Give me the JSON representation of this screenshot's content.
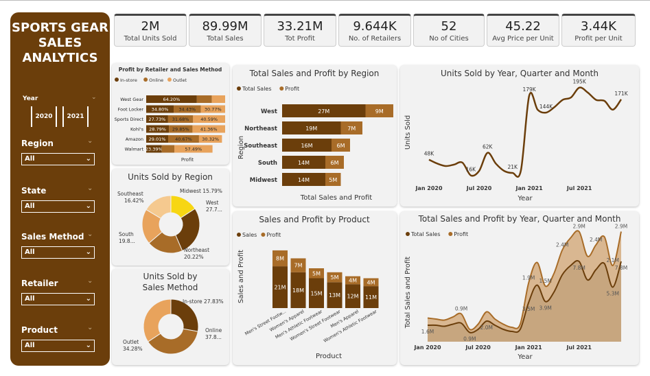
{
  "colors": {
    "dark": "#6b3e0b",
    "mid": "#a86c28",
    "light": "#e8a35c",
    "pale": "#f5c98f",
    "yellow": "#f7d613",
    "panel": "#f2f2f2"
  },
  "sidebar": {
    "title_l1": "SPORTS GEAR",
    "title_l2": "SALES",
    "title_l3": "ANALYTICS",
    "year_label": "Year",
    "year_buttons": [
      "2020",
      "2021"
    ],
    "filters": [
      {
        "label": "Region",
        "value": "All"
      },
      {
        "label": "State",
        "value": "All"
      },
      {
        "label": "Sales Method",
        "value": "All"
      },
      {
        "label": "Retailer",
        "value": "All"
      },
      {
        "label": "Product",
        "value": "All"
      }
    ]
  },
  "kpis": [
    {
      "value": "2M",
      "label": "Total Units Sold"
    },
    {
      "value": "89.99M",
      "label": "Total Sales"
    },
    {
      "value": "33.21M",
      "label": "Tot Profit"
    },
    {
      "value": "9.644K",
      "label": "No. of Retailers"
    },
    {
      "value": "52",
      "label": "No of Cities"
    },
    {
      "value": "45.22",
      "label": "Avg Price per Unit"
    },
    {
      "value": "3.44K",
      "label": "Profit per Unit"
    }
  ],
  "chart_data": [
    {
      "id": "retailer",
      "type": "bar",
      "title": "Profit by Retailer and Sales Method",
      "xlabel": "Profit",
      "legend": [
        "In-store",
        "Online",
        "Outlet"
      ],
      "categories": [
        "West Gear",
        "Foot Locker",
        "Sports Direct",
        "Kohl's",
        "Amazon",
        "Walmart"
      ],
      "totals": [
        100,
        100,
        100,
        100,
        96,
        84
      ],
      "series": [
        {
          "name": "In-store",
          "values": [
            64.2,
            34.8,
            27.73,
            28.79,
            29.01,
            23.39
          ],
          "labels": [
            "64.20%",
            "34.80%",
            "27.73%",
            "28.79%",
            "29.01%",
            "23.39%"
          ]
        },
        {
          "name": "Online",
          "values": [
            19.0,
            34.43,
            31.68,
            29.85,
            40.67,
            19.1
          ],
          "labels": [
            "",
            "34.43%",
            "31.68%",
            "29.85%",
            "40.67%",
            ""
          ]
        },
        {
          "name": "Outlet",
          "values": [
            16.8,
            30.77,
            40.59,
            41.36,
            30.32,
            57.49
          ],
          "labels": [
            "",
            "30.77%",
            "40.59%",
            "41.36%",
            "30.32%",
            "57.49%"
          ]
        }
      ]
    },
    {
      "id": "region_pie",
      "type": "pie",
      "title": "Units Sold by Region",
      "slices": [
        {
          "name": "Midwest",
          "value": 15.79,
          "label": "Midwest 15.79%"
        },
        {
          "name": "West",
          "value": 27.7,
          "label": "West 27.7..."
        },
        {
          "name": "Northeast",
          "value": 20.22,
          "label": "Northeast 20.22%"
        },
        {
          "name": "South",
          "value": 19.8,
          "label": "South 19.8..."
        },
        {
          "name": "Southeast",
          "value": 16.42,
          "label": "Southeast 16.42%"
        }
      ]
    },
    {
      "id": "method_pie",
      "type": "pie",
      "title": "Units Sold by Sales Method",
      "slices": [
        {
          "name": "In-store",
          "value": 27.83,
          "label": "In-store 27.83%"
        },
        {
          "name": "Online",
          "value": 37.8,
          "label": "Online 37.8..."
        },
        {
          "name": "Outlet",
          "value": 34.28,
          "label": "Outlet 34.28%"
        }
      ]
    },
    {
      "id": "region_bar",
      "type": "bar",
      "title": "Total Sales and Profit by Region",
      "xlabel": "Total Sales and Profit",
      "ylabel": "Region",
      "legend": [
        "Total Sales",
        "Profit"
      ],
      "categories": [
        "West",
        "Northeast",
        "Southeast",
        "South",
        "Midwest"
      ],
      "series": [
        {
          "name": "Total Sales",
          "values": [
            27,
            19,
            16,
            14,
            14
          ],
          "labels": [
            "27M",
            "19M",
            "16M",
            "14M",
            "14M"
          ]
        },
        {
          "name": "Profit",
          "values": [
            9,
            7,
            6,
            6,
            5
          ],
          "labels": [
            "9M",
            "7M",
            "6M",
            "6M",
            "5M"
          ]
        }
      ]
    },
    {
      "id": "product_bar",
      "type": "bar",
      "title": "Sales and Profit by Product",
      "xlabel": "Product",
      "ylabel": "Sales and Profit",
      "legend": [
        "Sales",
        "Profit"
      ],
      "categories": [
        "Men's Street Footw...",
        "Women's Apparel",
        "Men's Athletic Footwear",
        "Women's Street Footwear",
        "Men's Apparel",
        "Women's Athletic Footwear"
      ],
      "series": [
        {
          "name": "Sales",
          "values": [
            21,
            18,
            15,
            13,
            12,
            11
          ],
          "labels": [
            "21M",
            "18M",
            "15M",
            "13M",
            "12M",
            "11M"
          ]
        },
        {
          "name": "Profit",
          "values": [
            8,
            7,
            5,
            5,
            4,
            4
          ],
          "labels": [
            "8M",
            "7M",
            "5M",
            "5M",
            "4M",
            "4M"
          ]
        }
      ]
    },
    {
      "id": "units_line",
      "type": "line",
      "title": "Units Sold by Year, Quarter and Month",
      "xlabel": "Year",
      "ylabel": "Units Sold",
      "x_ticks": [
        "Jan 2020",
        "Jul 2020",
        "Jan 2021",
        "Jul 2021"
      ],
      "values": [
        48,
        40,
        35,
        38,
        42,
        16,
        25,
        62,
        40,
        25,
        21,
        26,
        179,
        150,
        144,
        155,
        170,
        175,
        195,
        185,
        170,
        168,
        150,
        171
      ],
      "point_labels": [
        {
          "index": 0,
          "text": "48K"
        },
        {
          "index": 5,
          "text": "16K"
        },
        {
          "index": 7,
          "text": "62K"
        },
        {
          "index": 10,
          "text": "21K"
        },
        {
          "index": 12,
          "text": "179K"
        },
        {
          "index": 14,
          "text": "144K"
        },
        {
          "index": 18,
          "text": "195K"
        },
        {
          "index": 23,
          "text": "171K"
        }
      ],
      "ylim": [
        0,
        210
      ]
    },
    {
      "id": "sales_area",
      "type": "area",
      "title": "Total Sales and Profit by Year, Quarter and Month",
      "xlabel": "Year",
      "ylabel": "Total Sales and Profit",
      "legend": [
        "Total Sales",
        "Profit"
      ],
      "x_ticks": [
        "Jan 2020",
        "Jul 2020",
        "Jan 2021",
        "Jul 2021"
      ],
      "series": [
        {
          "name": "Total Sales",
          "values": [
            1.6,
            1.6,
            1.5,
            1.7,
            1.8,
            0.9,
            1.2,
            2.0,
            1.6,
            1.2,
            1.0,
            1.2,
            3.8,
            5.5,
            3.9,
            4.8,
            6.5,
            7.4,
            7.8,
            6.0,
            7.0,
            7.6,
            5.3,
            7.8
          ]
        },
        {
          "name": "Profit",
          "values": [
            0.7,
            0.6,
            0.6,
            0.7,
            0.9,
            0.3,
            0.5,
            0.9,
            0.6,
            0.5,
            0.4,
            0.5,
            1.9,
            2.2,
            1.5,
            1.8,
            2.4,
            2.7,
            2.9,
            2.3,
            2.4,
            2.6,
            2.1,
            2.9
          ]
        }
      ],
      "point_labels": [
        {
          "text": "1.6M",
          "index": 0,
          "series": 0
        },
        {
          "text": "0.9M",
          "index": 4,
          "series": 1
        },
        {
          "text": "0.9M",
          "index": 5,
          "series": 0
        },
        {
          "text": "2.0M",
          "index": 7,
          "series": 0
        },
        {
          "text": "1.9M",
          "index": 12,
          "series": 1
        },
        {
          "text": "3.5M",
          "index": 12,
          "series": 0
        },
        {
          "text": "1.5M",
          "index": 14,
          "series": 1
        },
        {
          "text": "3.9M",
          "index": 14,
          "series": 0
        },
        {
          "text": "2.4M",
          "index": 16,
          "series": 1
        },
        {
          "text": "2.9M",
          "index": 18,
          "series": 1
        },
        {
          "text": "7.8M",
          "index": 18,
          "series": 0
        },
        {
          "text": "2.4M",
          "index": 20,
          "series": 1
        },
        {
          "text": "2.1M",
          "index": 22,
          "series": 1
        },
        {
          "text": "5.3M",
          "index": 22,
          "series": 0
        },
        {
          "text": "2.9M",
          "index": 23,
          "series": 1
        },
        {
          "text": "7.8M",
          "index": 23,
          "series": 0
        }
      ],
      "ylim": [
        0,
        10
      ]
    }
  ]
}
